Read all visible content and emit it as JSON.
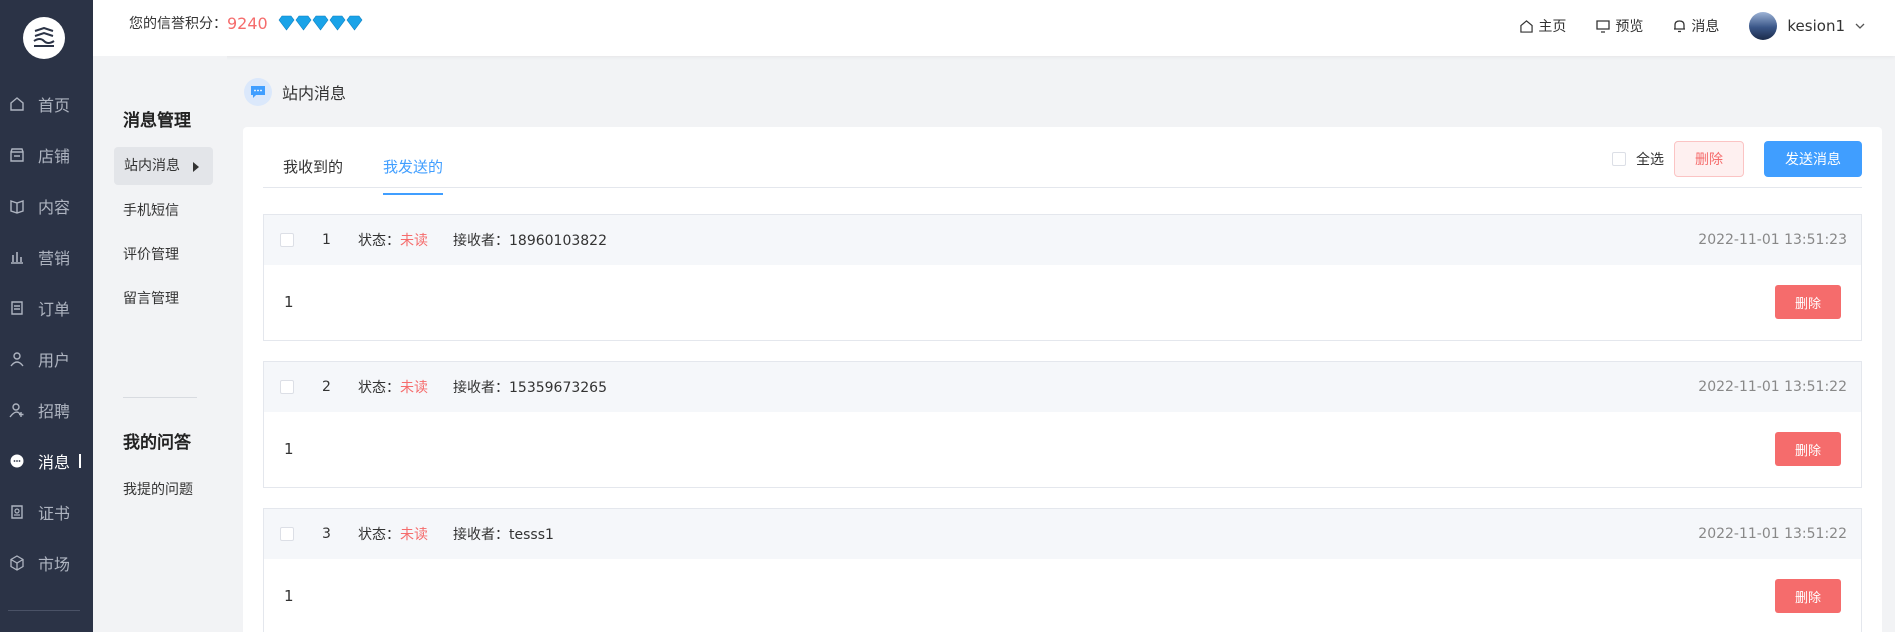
{
  "topbar": {
    "credit_label": "您的信誉积分：",
    "credit_score": "9240",
    "links": [
      {
        "icon": "home-icon",
        "label": "主页"
      },
      {
        "icon": "monitor-icon",
        "label": "预览"
      },
      {
        "icon": "bell-icon",
        "label": "消息"
      }
    ],
    "username": "kesion1"
  },
  "nav": {
    "items": [
      {
        "icon": "home-icon",
        "label": "首页"
      },
      {
        "icon": "shop-icon",
        "label": "店铺"
      },
      {
        "icon": "book-icon",
        "label": "内容"
      },
      {
        "icon": "bar-chart-icon",
        "label": "营销"
      },
      {
        "icon": "order-icon",
        "label": "订单"
      },
      {
        "icon": "user-icon",
        "label": "用户"
      },
      {
        "icon": "recruit-icon",
        "label": "招聘"
      },
      {
        "icon": "message-icon",
        "label": "消息"
      },
      {
        "icon": "certificate-icon",
        "label": "证书"
      },
      {
        "icon": "market-icon",
        "label": "市场"
      }
    ],
    "active_index": 7
  },
  "subnav": {
    "section1_title": "消息管理",
    "section1_items": [
      "站内消息",
      "手机短信",
      "评价管理",
      "留言管理"
    ],
    "section2_title": "我的问答",
    "section2_items": [
      "我提的问题"
    ]
  },
  "breadcrumb": {
    "title": "站内消息"
  },
  "tabs": [
    {
      "label": "我收到的"
    },
    {
      "label": "我发送的"
    }
  ],
  "actions": {
    "select_all": "全选",
    "delete": "删除",
    "send": "发送消息"
  },
  "messages": [
    {
      "index": "1",
      "status_label": "状态：",
      "status": "未读",
      "recipient_label": "接收者：",
      "recipient": "18960103822",
      "time": "2022-11-01 13:51:23",
      "content": "1",
      "delete": "删除"
    },
    {
      "index": "2",
      "status_label": "状态：",
      "status": "未读",
      "recipient_label": "接收者：",
      "recipient": "15359673265",
      "time": "2022-11-01 13:51:22",
      "content": "1",
      "delete": "删除"
    },
    {
      "index": "3",
      "status_label": "状态：",
      "status": "未读",
      "recipient_label": "接收者：",
      "recipient": "tesss1",
      "time": "2022-11-01 13:51:22",
      "content": "1",
      "delete": "删除"
    }
  ],
  "colors": {
    "nav_bg": "#2b3346",
    "accent": "#409eff",
    "danger": "#f56c6c"
  }
}
